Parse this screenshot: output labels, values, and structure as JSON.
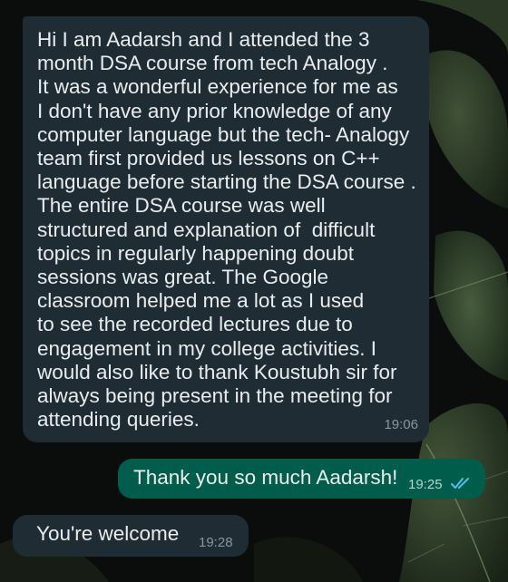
{
  "colors": {
    "incoming_bubble": "#1f2c34",
    "outgoing_bubble": "#005c4b",
    "message_text": "#e9edef",
    "timestamp": "#8696a0",
    "read_ticks": "#53bdeb"
  },
  "messages": [
    {
      "direction": "incoming",
      "text": "Hi I am Aadarsh and I attended the 3\nmonth DSA course from tech Analogy .\nIt was a wonderful experience for me as\nI don't have any prior knowledge of any\ncomputer language but the tech- Analogy\nteam first provided us lessons on C++\nlanguage before starting the DSA course .\nThe entire DSA course was well\nstructured and explanation of  difficult\ntopics in regularly happening doubt\nsessions was great. The Google\nclassroom helped me a lot as I used\nto see the recorded lectures due to\nengagement in my college activities. I\nwould also like to thank Koustubh sir for\nalways being present in the meeting for\nattending queries.",
      "time": "19:06"
    },
    {
      "direction": "outgoing",
      "text": "Thank you so much Aadarsh!",
      "time": "19:25",
      "status_icon": "double-check-read-icon"
    },
    {
      "direction": "incoming",
      "text": "You're welcome",
      "time": "19:28"
    }
  ]
}
